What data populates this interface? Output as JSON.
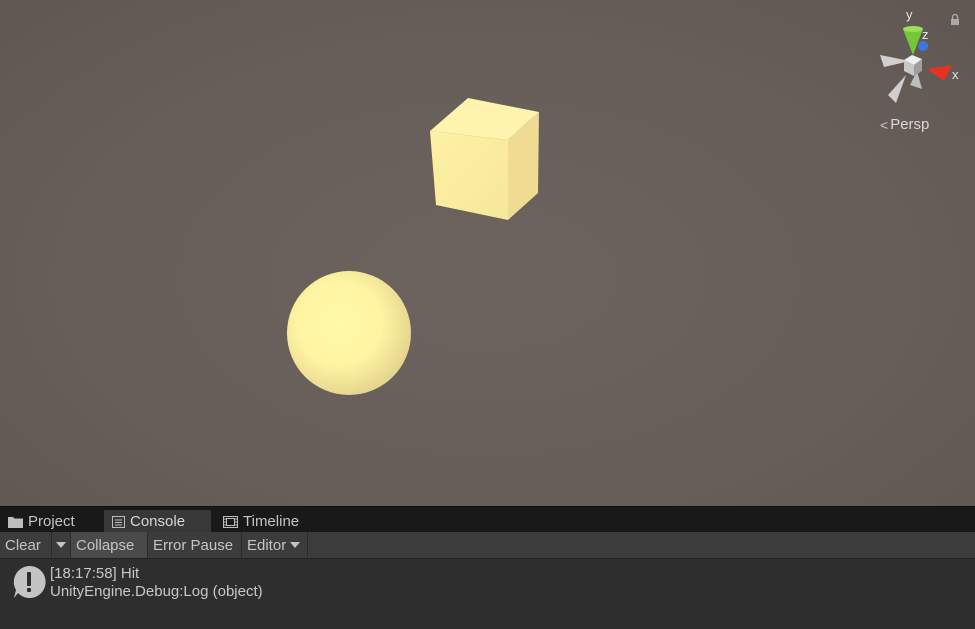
{
  "scene_view": {
    "gizmo_axes": {
      "y": "y",
      "z": "z",
      "x": "x"
    },
    "projection_label": "Persp",
    "colors": {
      "background": "#675e59",
      "cube": "#fff0a3",
      "sphere": "#fff5a5",
      "x_axis": "#e8321f",
      "y_axis": "#76c638",
      "z_axis": "#3a78e0"
    }
  },
  "tabs": [
    {
      "label": "Project",
      "icon": "folder-icon"
    },
    {
      "label": "Console",
      "icon": "console-icon"
    },
    {
      "label": "Timeline",
      "icon": "film-icon"
    }
  ],
  "toolbar": {
    "clear_label": "Clear",
    "collapse_label": "Collapse",
    "error_pause_label": "Error Pause",
    "editor_label": "Editor"
  },
  "log": {
    "entries": [
      {
        "line1": "[18:17:58] Hit",
        "line2": "UnityEngine.Debug:Log (object)",
        "icon": "info-icon"
      }
    ]
  }
}
